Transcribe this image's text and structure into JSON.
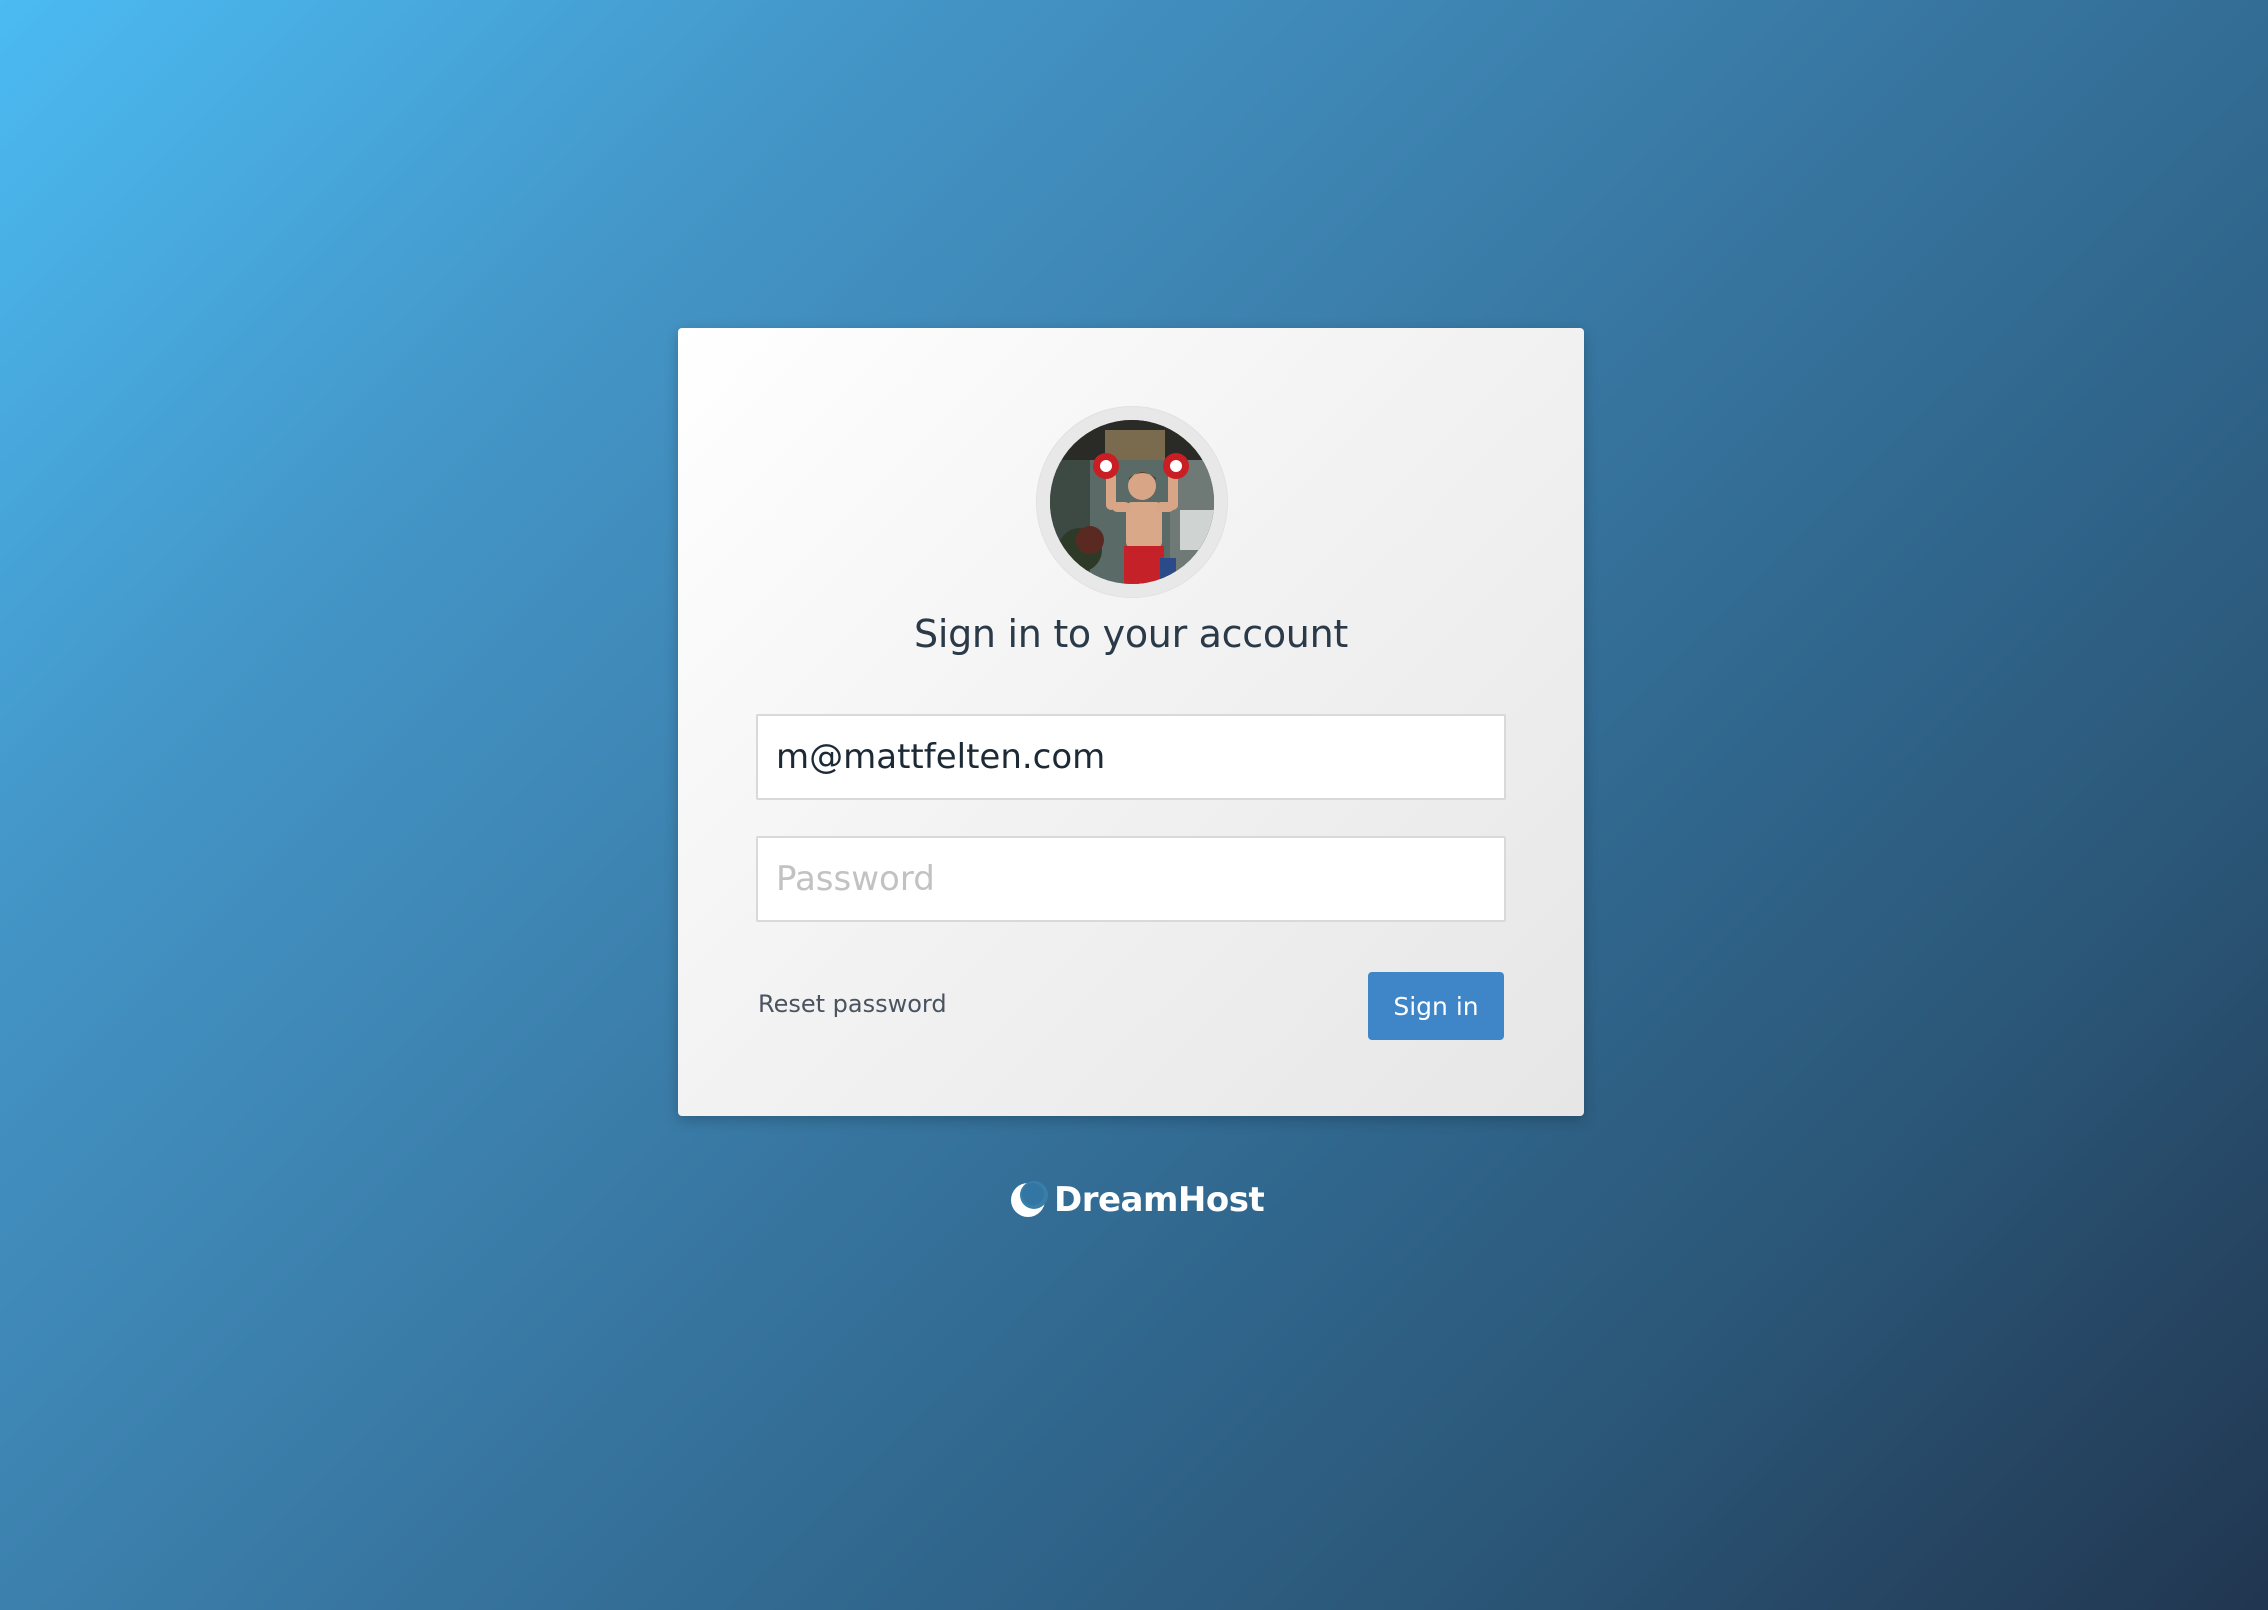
{
  "login": {
    "title": "Sign in to your account",
    "email_value": "m@mattfelten.com",
    "password_placeholder": "Password",
    "reset_label": "Reset password",
    "signin_label": "Sign in"
  },
  "brand": {
    "name": "DreamHost",
    "icon": "dreamhost-moon-logo"
  },
  "colors": {
    "primary_button": "#3f86c9",
    "background_start": "#4bbbf2",
    "background_end": "#213650"
  },
  "avatar": {
    "icon": "user-avatar-photo"
  }
}
